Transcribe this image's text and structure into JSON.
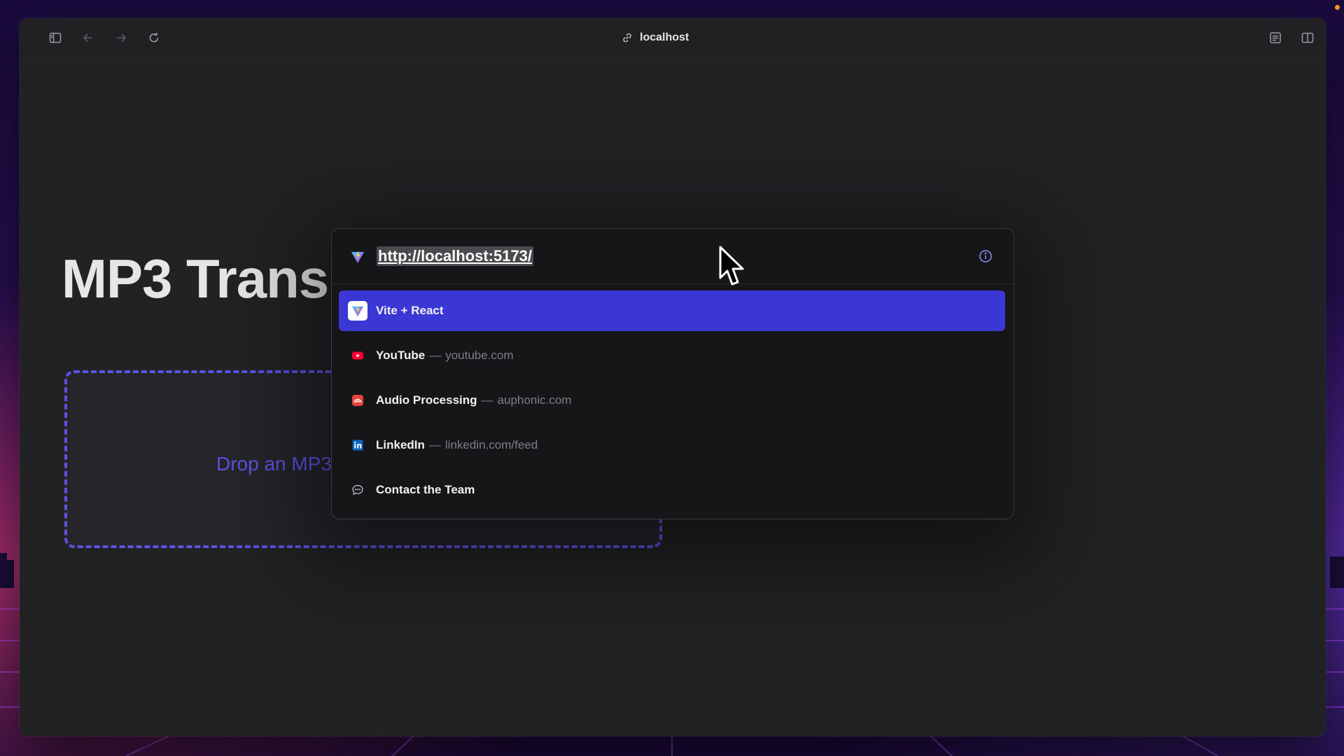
{
  "toolbar": {
    "address": "localhost",
    "icons": {
      "sidebar": "sidebar-toggle-icon",
      "back": "arrow-left-icon",
      "forward": "arrow-right-icon",
      "reload": "reload-icon",
      "link": "link-icon",
      "reader": "reader-icon",
      "split": "split-view-icon"
    }
  },
  "page": {
    "title": "MP3 Trans",
    "dropzone_text": "Drop an MP3"
  },
  "popover": {
    "url": "http://localhost:5173/",
    "suggestions": [
      {
        "title": "Vite + React",
        "domain": "",
        "icon": "vite-icon",
        "selected": true
      },
      {
        "title": "YouTube",
        "domain": "youtube.com",
        "icon": "youtube-icon",
        "selected": false
      },
      {
        "title": "Audio Processing",
        "domain": "auphonic.com",
        "icon": "auphonic-icon",
        "selected": false
      },
      {
        "title": "LinkedIn",
        "domain": "linkedin.com/feed",
        "icon": "linkedin-icon",
        "selected": false
      },
      {
        "title": "Contact the Team",
        "domain": "",
        "icon": "chat-bubble-icon",
        "selected": false
      }
    ],
    "separator": "—"
  },
  "colors": {
    "accent": "#3b37d4",
    "dropzone": "#5b52e6",
    "youtube": "#ff0033",
    "auphonic": "#e8423c",
    "linkedin": "#0a66c2"
  }
}
